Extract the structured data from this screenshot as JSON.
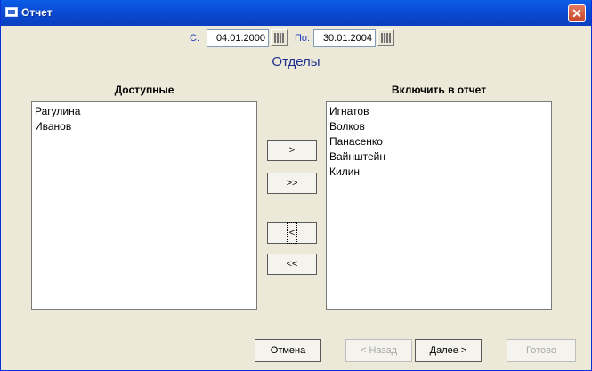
{
  "window": {
    "title": "Отчет"
  },
  "dates": {
    "from_label": "С:",
    "from_value": "04.01.2000",
    "to_label": "По:",
    "to_value": "30.01.2004"
  },
  "section_title": "Отделы",
  "available": {
    "title": "Доступные",
    "items": [
      "Рагулина",
      "Иванов"
    ]
  },
  "included": {
    "title": "Включить в отчет",
    "items": [
      "Игнатов",
      "Волков",
      "Панасенко",
      "Вайнштейн",
      "Килин"
    ]
  },
  "move_buttons": {
    "add_one": ">",
    "add_all": ">>",
    "remove_one": "<",
    "remove_all": "<<"
  },
  "footer": {
    "cancel": "Отмена",
    "back": "< Назад",
    "next": "Далее >",
    "finish": "Готово"
  }
}
